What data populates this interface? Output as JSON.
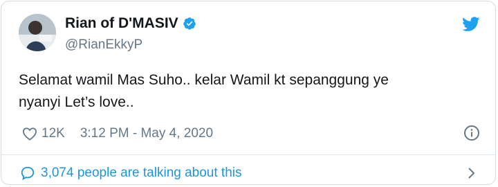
{
  "user": {
    "display_name": "Rian of D'MASIV",
    "handle": "@RianEkkyP",
    "verified": true
  },
  "tweet": {
    "text_line1": "Selamat wamil Mas Suho.. kelar Wamil kt sepanggung ye",
    "text_line2": "nyanyi Let’s love.."
  },
  "meta": {
    "likes": "12K",
    "timestamp": "3:12 PM - May 4, 2020"
  },
  "footer": {
    "talking_text": "3,074 people are talking about this"
  },
  "colors": {
    "brand_blue": "#1da1f2",
    "link_blue": "#1b95e0",
    "muted_gray": "#657786"
  },
  "icons": [
    "twitter-bird-icon",
    "verified-badge-icon",
    "heart-icon",
    "info-icon",
    "comment-bubble-icon",
    "chevron-right-icon"
  ]
}
